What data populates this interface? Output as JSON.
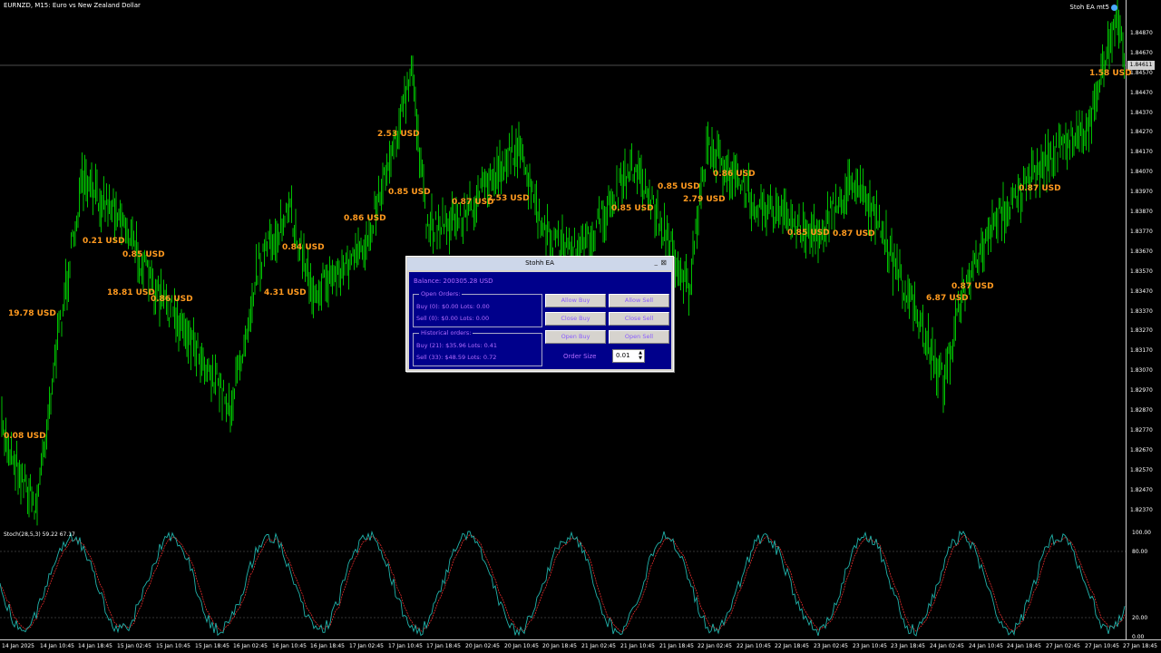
{
  "chart": {
    "title": "EURNZD, M15:  Euro vs New Zealand Dollar",
    "ea_tag": "Stoh EA mt5",
    "current_price": "1.84611",
    "price_ticks": [
      "1.84870",
      "1.84670",
      "1.84570",
      "1.84470",
      "1.84370",
      "1.84270",
      "1.84170",
      "1.84070",
      "1.83970",
      "1.83870",
      "1.83770",
      "1.83670",
      "1.83570",
      "1.83470",
      "1.83370",
      "1.83270",
      "1.83170",
      "1.83070",
      "1.82970",
      "1.82870",
      "1.82770",
      "1.82670",
      "1.82570",
      "1.82470",
      "1.82370"
    ],
    "pnl_labels": [
      "19.78 USD",
      "0.08 USD",
      "0.21 USD",
      "0.85 USD",
      "18.81 USD",
      "0.86 USD",
      "4.31 USD",
      "0.84 USD",
      "0.86 USD",
      "2.53 USD",
      "0.85 USD",
      "0.87 USD",
      "2.53 USD",
      "0.85 USD",
      "0.85 USD",
      "2.79 USD",
      "0.86 USD",
      "0.85 USD",
      "0.87 USD",
      "6.87 USD",
      "0.87 USD",
      "0.87 USD",
      "1.58 USD"
    ]
  },
  "stochastic": {
    "label": "Stoch(28,5,3) 59.22 67.17",
    "ticks": [
      "100.00",
      "80.00",
      "20.00",
      "0.00"
    ]
  },
  "time_axis": [
    "14 Jan 2025",
    "14 Jan 10:45",
    "14 Jan 18:45",
    "15 Jan 02:45",
    "15 Jan 10:45",
    "15 Jan 18:45",
    "16 Jan 02:45",
    "16 Jan 10:45",
    "16 Jan 18:45",
    "17 Jan 02:45",
    "17 Jan 10:45",
    "17 Jan 18:45",
    "20 Jan 02:45",
    "20 Jan 10:45",
    "20 Jan 18:45",
    "21 Jan 02:45",
    "21 Jan 10:45",
    "21 Jan 18:45",
    "22 Jan 02:45",
    "22 Jan 10:45",
    "22 Jan 18:45",
    "23 Jan 02:45",
    "23 Jan 10:45",
    "23 Jan 18:45",
    "24 Jan 02:45",
    "24 Jan 10:45",
    "24 Jan 18:45",
    "27 Jan 02:45",
    "27 Jan 10:45",
    "27 Jan 18:45"
  ],
  "panel": {
    "title": "Stohh EA",
    "min_icon": "_",
    "close_icon": "⊠",
    "balance": "Balance: 200305.28 USD",
    "open_orders": {
      "title": "Open Orders:",
      "buy": "Buy (0): $0.00 Lots: 0.00",
      "sell": "Sell (0): $0.00 Lots: 0.00"
    },
    "historical_orders": {
      "title": "Historical orders:",
      "buy": "Buy (21): $35.96 Lots: 0.41",
      "sell": "Sell (33): $48.59 Lots: 0.72"
    },
    "buttons": {
      "allow_buy": "Allow Buy",
      "allow_sell": "Allow Sell",
      "close_buy": "Close Buy",
      "close_sell": "Close Sell",
      "open_buy": "Open Buy",
      "open_sell": "Open Sell"
    },
    "order_size_label": "Order Size",
    "order_size_value": "0.01",
    "spin_up": "▲",
    "spin_down": "▼"
  },
  "colors": {
    "candles": "#00c000",
    "pnl": "#ff9a1f",
    "stoch_main": "#20b2aa",
    "stoch_signal": "#ff3030",
    "panel_bg": "#00008b",
    "panel_text": "#b36bff"
  }
}
